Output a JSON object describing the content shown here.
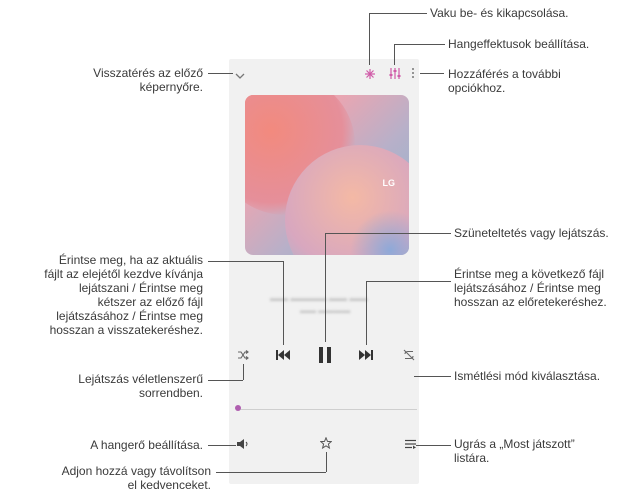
{
  "labels": {
    "flash": "Vaku be- és kikapcsolása.",
    "sound_effects": "Hangeffektusok beállítása.",
    "more_options": [
      "Hozzáférés a további",
      "opciókhoz."
    ],
    "back": [
      "Visszatérés az előző",
      "képernyőre."
    ],
    "pause_play": "Szüneteltetés vagy lejátszás.",
    "previous": [
      "Érintse meg, ha az aktuális",
      "fájlt az elejétől kezdve kívánja",
      "lejátszani / Érintse meg",
      "kétszer az előző fájl",
      "lejátszásához / Érintse meg",
      "hosszan a visszatekeréshez."
    ],
    "next": [
      "Érintse meg a következő fájl",
      "lejátszásához / Érintse meg",
      "hosszan az előretekeréshez."
    ],
    "shuffle": [
      "Lejátszás véletlenszerű",
      "sorrendben."
    ],
    "repeat": "Ismétlési mód kiválasztása.",
    "volume": "A hangerő beállítása.",
    "favorites": [
      "Adjon hozzá vagy távolítson",
      "el kedvenceket."
    ],
    "now_playing": [
      "Ugrás a „Most játszott”",
      "listára."
    ]
  },
  "album_logo": "LG",
  "icons": {
    "back": "chevron-down-icon",
    "flash": "flash-icon",
    "equalizer": "equalizer-icon",
    "more": "more-icon",
    "previous": "previous-icon",
    "pause": "pause-icon",
    "next": "next-icon",
    "shuffle": "shuffle-icon",
    "repeat": "repeat-off-icon",
    "volume": "volume-icon",
    "favorite": "star-icon",
    "playlist": "playlist-icon"
  }
}
